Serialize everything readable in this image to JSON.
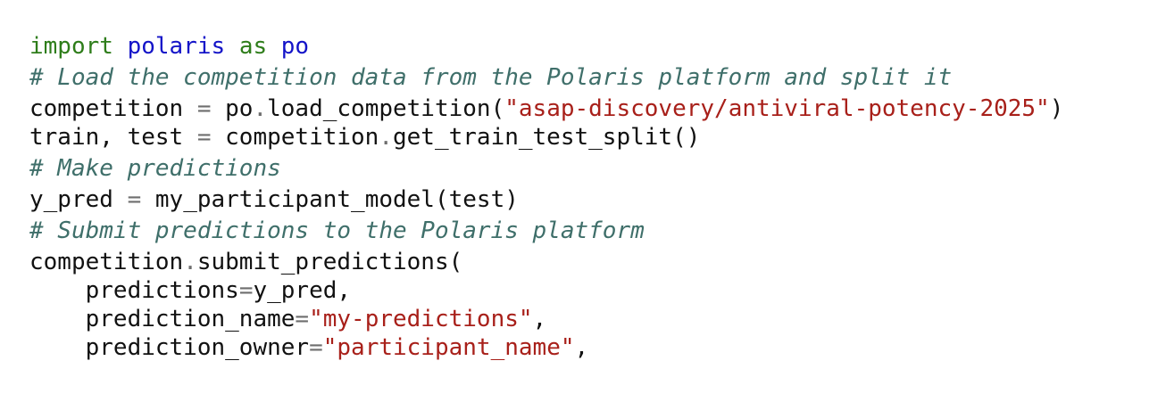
{
  "code": {
    "lines": [
      {
        "kind": "code",
        "tokens": [
          {
            "type": "keyword",
            "text": "import"
          },
          {
            "type": "plain",
            "text": " "
          },
          {
            "type": "name",
            "text": "polaris"
          },
          {
            "type": "plain",
            "text": " "
          },
          {
            "type": "keyword",
            "text": "as"
          },
          {
            "type": "plain",
            "text": " "
          },
          {
            "type": "name",
            "text": "po"
          }
        ]
      },
      {
        "kind": "comment",
        "tokens": [
          {
            "type": "comment",
            "text": "# Load the competition data from the Polaris platform and split it"
          }
        ]
      },
      {
        "kind": "code",
        "tokens": [
          {
            "type": "plain",
            "text": "competition "
          },
          {
            "type": "op",
            "text": "="
          },
          {
            "type": "plain",
            "text": " po"
          },
          {
            "type": "op",
            "text": "."
          },
          {
            "type": "plain",
            "text": "load_competition("
          },
          {
            "type": "string",
            "text": "\"asap-discovery/antiviral-potency-2025\""
          },
          {
            "type": "plain",
            "text": ")"
          }
        ]
      },
      {
        "kind": "code",
        "tokens": [
          {
            "type": "plain",
            "text": "train, test "
          },
          {
            "type": "op",
            "text": "="
          },
          {
            "type": "plain",
            "text": " competition"
          },
          {
            "type": "op",
            "text": "."
          },
          {
            "type": "plain",
            "text": "get_train_test_split()"
          }
        ]
      },
      {
        "kind": "comment",
        "tokens": [
          {
            "type": "comment",
            "text": "# Make predictions"
          }
        ]
      },
      {
        "kind": "code",
        "tokens": [
          {
            "type": "plain",
            "text": "y_pred "
          },
          {
            "type": "op",
            "text": "="
          },
          {
            "type": "plain",
            "text": " my_participant_model(test)"
          }
        ]
      },
      {
        "kind": "comment",
        "tokens": [
          {
            "type": "comment",
            "text": "# Submit predictions to the Polaris platform"
          }
        ]
      },
      {
        "kind": "code",
        "tokens": [
          {
            "type": "plain",
            "text": "competition"
          },
          {
            "type": "op",
            "text": "."
          },
          {
            "type": "plain",
            "text": "submit_predictions("
          }
        ]
      },
      {
        "kind": "code",
        "tokens": [
          {
            "type": "plain",
            "text": "    predictions"
          },
          {
            "type": "op",
            "text": "="
          },
          {
            "type": "plain",
            "text": "y_pred,"
          }
        ]
      },
      {
        "kind": "code",
        "tokens": [
          {
            "type": "plain",
            "text": "    prediction_name"
          },
          {
            "type": "op",
            "text": "="
          },
          {
            "type": "string",
            "text": "\"my-predictions\""
          },
          {
            "type": "plain",
            "text": ","
          }
        ]
      },
      {
        "kind": "code",
        "tokens": [
          {
            "type": "plain",
            "text": "    prediction_owner"
          },
          {
            "type": "op",
            "text": "="
          },
          {
            "type": "string",
            "text": "\"participant_name\""
          },
          {
            "type": "plain",
            "text": ","
          }
        ]
      }
    ]
  },
  "colors": {
    "keyword": "#2e7d1a",
    "name": "#1414c8",
    "comment": "#3f6f6a",
    "string": "#a8201a",
    "op": "#6e6e6e",
    "plain": "#111111"
  }
}
